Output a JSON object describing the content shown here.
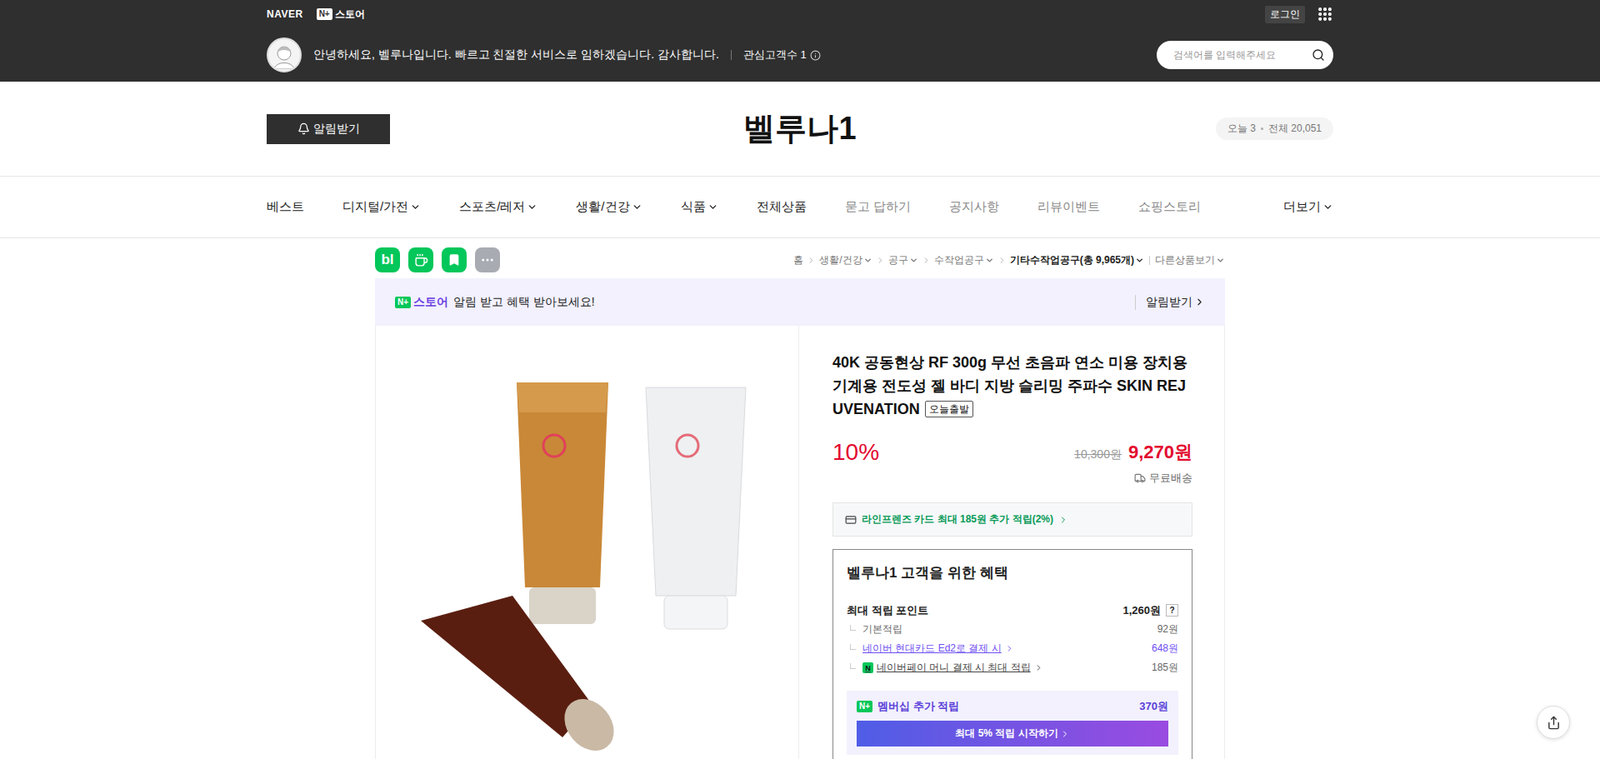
{
  "top_bar": {
    "naver": "NAVER",
    "nplus": "N+",
    "store": "스토어",
    "login": "로그인"
  },
  "greeting": {
    "message": "안녕하세요, 벨루나입니다. 빠르고 친절한 서비스로 임하겠습니다. 감사합니다.",
    "interest": "관심고객수 1",
    "search_placeholder": "검색어를 입력해주세요"
  },
  "store": {
    "name": "벨루나1",
    "notify": "알림받기",
    "visits_today": "오늘 3",
    "visits_total": "전체 20,051"
  },
  "nav": [
    {
      "label": "베스트",
      "dropdown": false,
      "muted": false
    },
    {
      "label": "디지털/가전",
      "dropdown": true,
      "muted": false
    },
    {
      "label": "스포츠/레저",
      "dropdown": true,
      "muted": false
    },
    {
      "label": "생활/건강",
      "dropdown": true,
      "muted": false
    },
    {
      "label": "식품",
      "dropdown": true,
      "muted": false
    },
    {
      "label": "전체상품",
      "dropdown": false,
      "muted": false
    },
    {
      "label": "묻고 답하기",
      "dropdown": false,
      "muted": true
    },
    {
      "label": "공지사항",
      "dropdown": false,
      "muted": true
    },
    {
      "label": "리뷰이벤트",
      "dropdown": false,
      "muted": true
    },
    {
      "label": "쇼핑스토리",
      "dropdown": false,
      "muted": true
    }
  ],
  "nav_more": "더보기",
  "blog_label": "bl",
  "breadcrumb": [
    {
      "label": "홈",
      "dropdown": false,
      "current": false
    },
    {
      "label": "생활/건강",
      "dropdown": true,
      "current": false
    },
    {
      "label": "공구",
      "dropdown": true,
      "current": false
    },
    {
      "label": "수작업공구",
      "dropdown": true,
      "current": false
    },
    {
      "label": "기타수작업공구(총 9,965개)",
      "dropdown": true,
      "current": true
    }
  ],
  "other_products": "다른상품보기",
  "banner": {
    "nplus": "N+",
    "brand": "스토어",
    "text": "알림 받고 혜택 받아보세요!",
    "action": "알림받기"
  },
  "product": {
    "title": "40K 공동현상 RF 300g 무선 초음파 연소 미용 장치용 기계용 전도성 젤 바디 지방 슬리밍 주파수 SKIN REJUVENATION",
    "badge": "오늘출발",
    "discount": "10%",
    "original_price": "10,300원",
    "price": "9,270원",
    "shipping": "무료배송"
  },
  "card_benefit": "라인프렌즈 카드 최대 185원 추가 적립(2%)",
  "benefits": {
    "title": "벨루나1 고객을 위한 혜택",
    "max_label": "최대 적립 포인트",
    "max_value": "1,260원",
    "help": "?",
    "items": [
      {
        "label": "기본적립",
        "value": "92원",
        "kind": "plain"
      },
      {
        "label": "네이버 현대카드 Ed2로 결제 시",
        "value": "648원",
        "kind": "link"
      },
      {
        "label": "네이버페이 머니 결제 시 최대 적립",
        "value": "185원",
        "kind": "npay"
      }
    ],
    "npay_letter": "N",
    "membership": {
      "nplus": "N+",
      "label": "멤버십 추가 적립",
      "value": "370원",
      "button": "최대 5% 적립 시작하기"
    }
  }
}
